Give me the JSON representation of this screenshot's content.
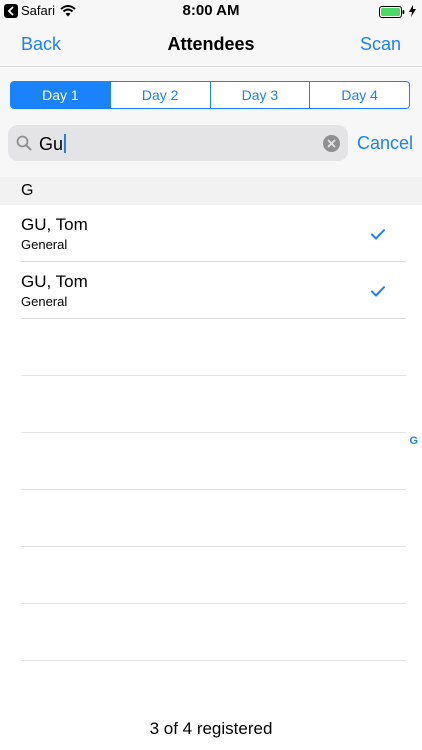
{
  "status_bar": {
    "back_app": "Safari",
    "time": "8:00 AM"
  },
  "nav": {
    "back_label": "Back",
    "title": "Attendees",
    "scan_label": "Scan"
  },
  "segments": {
    "items": [
      "Day 1",
      "Day 2",
      "Day 3",
      "Day 4"
    ],
    "selected": "Day 1"
  },
  "search": {
    "value": "Gu",
    "cancel_label": "Cancel"
  },
  "section": {
    "header": "G"
  },
  "attendees": [
    {
      "name": "GU, Tom",
      "type": "General",
      "checked": true
    },
    {
      "name": "GU, Tom",
      "type": "General",
      "checked": true
    }
  ],
  "index": [
    "G"
  ],
  "footer": {
    "summary": "3 of 4 registered"
  },
  "colors": {
    "accent": "#1a82fb",
    "battery": "#4cd964"
  }
}
